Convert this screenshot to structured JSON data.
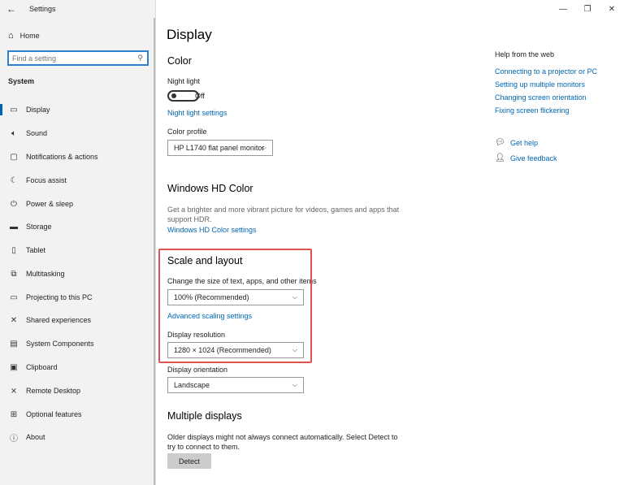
{
  "app": {
    "title": "Settings",
    "back_icon": "back-arrow-icon"
  },
  "sidebar": {
    "home": "Home",
    "search_placeholder": "Find a setting",
    "section": "System",
    "items": [
      {
        "label": "Display",
        "icon": "monitor-icon",
        "active": true
      },
      {
        "label": "Sound",
        "icon": "speaker-icon"
      },
      {
        "label": "Notifications & actions",
        "icon": "notifications-icon"
      },
      {
        "label": "Focus assist",
        "icon": "focus-icon"
      },
      {
        "label": "Power & sleep",
        "icon": "power-icon"
      },
      {
        "label": "Storage",
        "icon": "storage-icon"
      },
      {
        "label": "Tablet",
        "icon": "tablet-icon"
      },
      {
        "label": "Multitasking",
        "icon": "multitasking-icon"
      },
      {
        "label": "Projecting to this PC",
        "icon": "projecting-icon"
      },
      {
        "label": "Shared experiences",
        "icon": "shared-icon"
      },
      {
        "label": "System Components",
        "icon": "components-icon"
      },
      {
        "label": "Clipboard",
        "icon": "clipboard-icon"
      },
      {
        "label": "Remote Desktop",
        "icon": "remote-desktop-icon"
      },
      {
        "label": "Optional features",
        "icon": "optional-features-icon"
      },
      {
        "label": "About",
        "icon": "about-icon"
      }
    ]
  },
  "main": {
    "title": "Display",
    "color": {
      "heading": "Color",
      "night_light_label": "Night light",
      "night_light_state": "Off",
      "night_light_settings_link": "Night light settings",
      "color_profile_label": "Color profile",
      "color_profile_value": "HP L1740 flat panel monitor"
    },
    "hd_color": {
      "heading": "Windows HD Color",
      "description": "Get a brighter and more vibrant picture for videos, games and apps that support HDR.",
      "link": "Windows HD Color settings"
    },
    "scale_layout": {
      "heading": "Scale and layout",
      "size_label": "Change the size of text, apps, and other items",
      "size_value": "100% (Recommended)",
      "advanced_link": "Advanced scaling settings",
      "resolution_label": "Display resolution",
      "resolution_value": "1280 × 1024 (Recommended)",
      "orientation_label": "Display orientation",
      "orientation_value": "Landscape"
    },
    "multiple_displays": {
      "heading": "Multiple displays",
      "description": "Older displays might not always connect automatically. Select Detect to try to connect to them.",
      "detect_button": "Detect"
    }
  },
  "help": {
    "title": "Help from the web",
    "links": [
      "Connecting to a projector or PC",
      "Setting up multiple monitors",
      "Changing screen orientation",
      "Fixing screen flickering"
    ],
    "get_help": "Get help",
    "give_feedback": "Give feedback"
  },
  "colors": {
    "accent": "#0063b1",
    "link": "#0066b4",
    "highlight": "#e0514f"
  }
}
